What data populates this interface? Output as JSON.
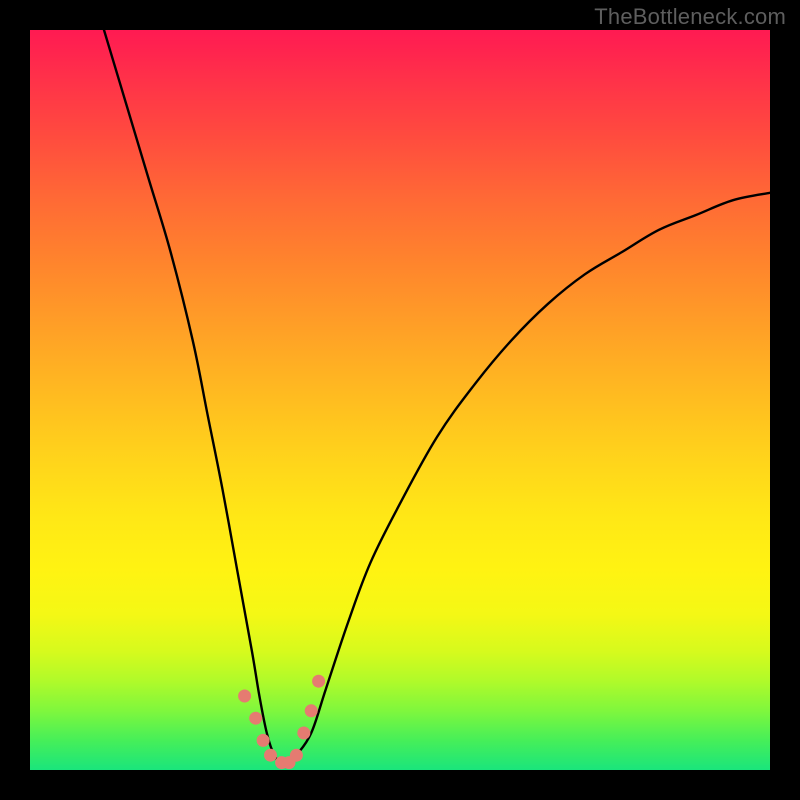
{
  "watermark": "TheBottleneck.com",
  "chart_data": {
    "type": "line",
    "title": "",
    "xlabel": "",
    "ylabel": "",
    "xlim": [
      0,
      100
    ],
    "ylim": [
      0,
      100
    ],
    "series": [
      {
        "name": "bottleneck-curve",
        "x": [
          10,
          13,
          16,
          19,
          22,
          24,
          26,
          28,
          30,
          31,
          32,
          33,
          34,
          35,
          36,
          38,
          40,
          43,
          46,
          50,
          55,
          60,
          65,
          70,
          75,
          80,
          85,
          90,
          95,
          100
        ],
        "values": [
          100,
          90,
          80,
          70,
          58,
          48,
          38,
          27,
          16,
          10,
          5,
          2,
          1,
          1,
          2,
          5,
          11,
          20,
          28,
          36,
          45,
          52,
          58,
          63,
          67,
          70,
          73,
          75,
          77,
          78
        ]
      },
      {
        "name": "markers",
        "x": [
          29,
          30.5,
          31.5,
          32.5,
          34,
          35,
          36,
          37,
          38,
          39
        ],
        "values": [
          10,
          7,
          4,
          2,
          1,
          1,
          2,
          5,
          8,
          12
        ]
      }
    ],
    "gradient_stops": [
      {
        "pos": 0,
        "color": "#ff1a52"
      },
      {
        "pos": 50,
        "color": "#ffbd20"
      },
      {
        "pos": 73,
        "color": "#fff312"
      },
      {
        "pos": 100,
        "color": "#1ae57c"
      }
    ]
  }
}
